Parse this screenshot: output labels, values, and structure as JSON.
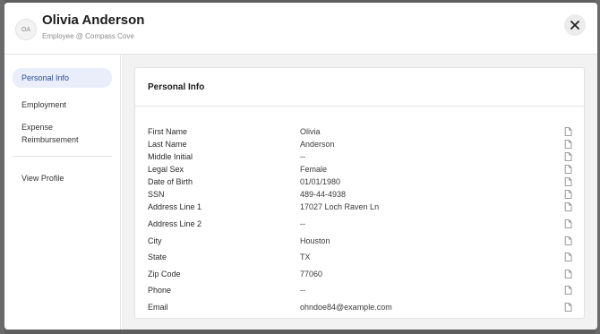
{
  "header": {
    "avatar_initials": "OA",
    "name": "Olivia Anderson",
    "subtitle": "Employee @ Compass Cove",
    "close_icon": "close-icon"
  },
  "sidebar": {
    "items": [
      {
        "label": "Personal Info",
        "active": true
      },
      {
        "label": "Employment",
        "active": false
      },
      {
        "label": "Expense Reimbursement",
        "active": false
      },
      {
        "label": "View Profile",
        "active": false
      }
    ]
  },
  "card": {
    "title": "Personal Info",
    "fields": [
      {
        "label": "First Name",
        "value": "Olivia"
      },
      {
        "label": "Last Name",
        "value": "Anderson"
      },
      {
        "label": "Middle Initial",
        "value": "--"
      },
      {
        "label": "Legal Sex",
        "value": "Female"
      },
      {
        "label": "Date of Birth",
        "value": "01/01/1980"
      },
      {
        "label": "SSN",
        "value": "489-44-4938"
      },
      {
        "label": "Address Line 1",
        "value": "17027 Loch Raven Ln"
      },
      {
        "label": "Address Line 2",
        "value": "--"
      },
      {
        "label": "City",
        "value": "Houston"
      },
      {
        "label": "State",
        "value": "TX"
      },
      {
        "label": "Zip Code",
        "value": "77060"
      },
      {
        "label": "Phone",
        "value": "--"
      },
      {
        "label": "Email",
        "value": "ohndoe84@example.com"
      }
    ],
    "copy_icon": "copy-icon"
  },
  "colors": {
    "active_nav_bg": "#e9eefa",
    "active_nav_text": "#2b4a9a",
    "content_bg": "#f2f2f2",
    "overlay": "#5e5e5e"
  }
}
